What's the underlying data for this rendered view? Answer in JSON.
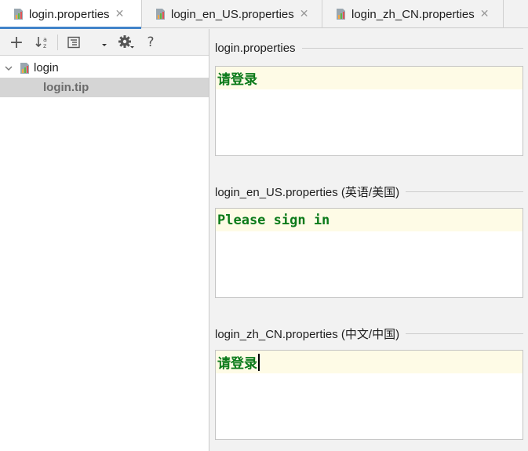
{
  "tabs": [
    {
      "label": "login.properties",
      "active": true
    },
    {
      "label": "login_en_US.properties",
      "active": false
    },
    {
      "label": "login_zh_CN.properties",
      "active": false
    }
  ],
  "toolbar": {
    "add_glyph": "+",
    "help_glyph": "?"
  },
  "tree": {
    "root": "login",
    "child": "login.tip"
  },
  "sections": [
    {
      "title": "login.properties",
      "value": "请登录"
    },
    {
      "title": "login_en_US.properties (英语/美国)",
      "value": "Please sign in"
    },
    {
      "title": "login_zh_CN.properties (中文/中国)",
      "value": "请登录"
    }
  ],
  "colors": {
    "accent": "#4083c9",
    "value_text": "#0b7a1a",
    "caret_line": "#fefbe6",
    "selection": "#d5d5d5"
  }
}
